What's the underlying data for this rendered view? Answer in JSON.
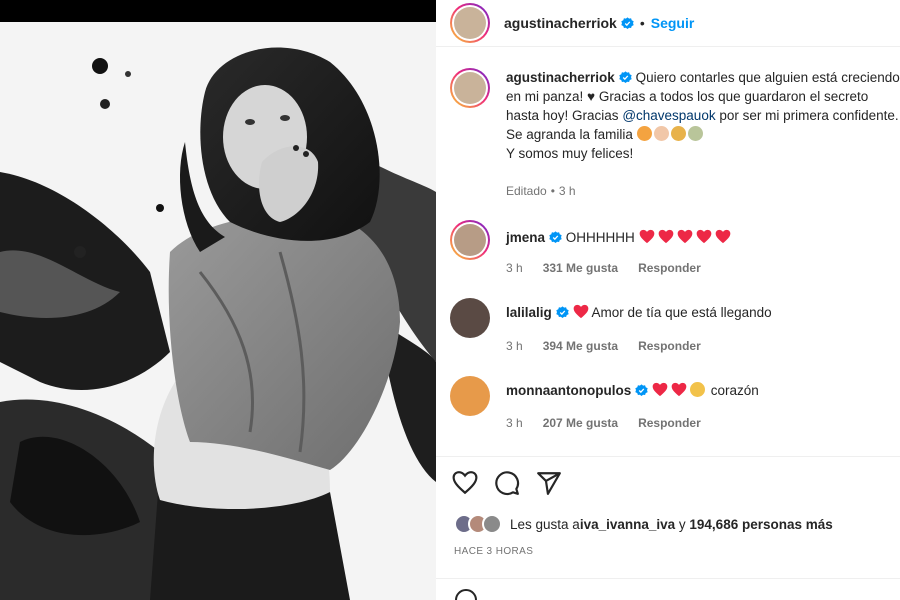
{
  "post": {
    "author": "agustinacherriok",
    "follow_label": "Seguir",
    "separator": "•",
    "caption": {
      "line1": "Quiero contarles que alguien está creciendo",
      "line2": "en mi panza! ♥ Gracias a todos los que guardaron el secreto",
      "line3a": "hasta hoy! Gracias ",
      "line3_mention": "@chavespauok",
      "line3b": " por ser mi primera confidente.",
      "line4": "Se agranda la familia",
      "line5": "Y somos muy felices!"
    },
    "edited_label": "Editado",
    "edited_time": "3 h"
  },
  "comments": [
    {
      "user": "jmena",
      "text": "OHHHHHH",
      "hearts": 5,
      "time": "3 h",
      "likes": "331 Me gusta",
      "reply": "Responder"
    },
    {
      "user": "lalilalig",
      "text": "Amor de tía que está llegando",
      "hearts": 1,
      "time": "3 h",
      "likes": "394 Me gusta",
      "reply": "Responder"
    },
    {
      "user": "monnaantonopulos",
      "text": "corazón",
      "hearts": 2,
      "time": "3 h",
      "likes": "207 Me gusta",
      "reply": "Responder"
    }
  ],
  "likes": {
    "prefix": "Les gusta a ",
    "user": "iva_ivanna_iva",
    "middle": " y ",
    "count": "194,686 personas más"
  },
  "posted_time": "HACE 3 HORAS",
  "icons": [
    "heart-outline-icon",
    "comment-icon",
    "share-icon",
    "verified-badge-icon",
    "emoji-icon"
  ],
  "colors": {
    "accent": "#0095f6",
    "heart": "#ed2846",
    "muted": "#737373",
    "mention": "#00376b"
  }
}
